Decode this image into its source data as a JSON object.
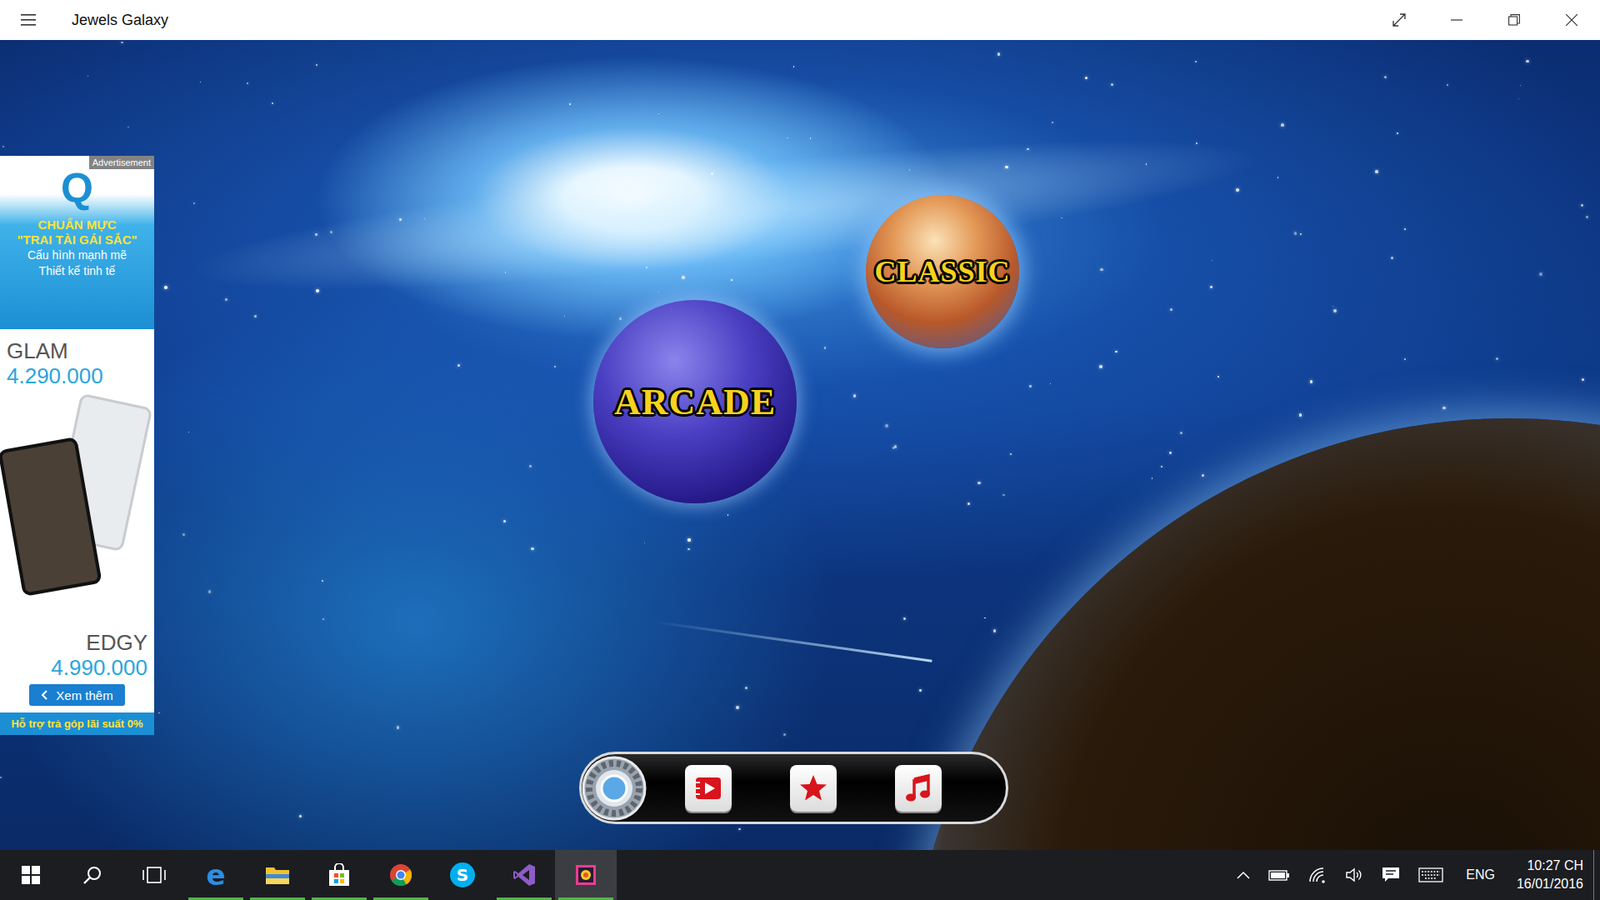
{
  "window": {
    "title": "Jewels Galaxy"
  },
  "modes": [
    {
      "label": "CLASSIC"
    },
    {
      "label": "ARCADE"
    }
  ],
  "advertisement": {
    "label": "Advertisement",
    "logo": "Q",
    "headline": [
      "CHUẨN MỰC",
      "\"TRAI TÀI GÁI SẮC\""
    ],
    "taglines": [
      "Cấu hình mạnh mẽ",
      "Thiết kế tinh tế"
    ],
    "products": [
      {
        "name": "GLAM",
        "price": "4.290.000"
      },
      {
        "name": "EDGY",
        "price": "4.990.000"
      }
    ],
    "button": "Xem thêm",
    "footer": "Hỗ trợ trả góp lãi suất 0%"
  },
  "taskbar": {
    "apps": [
      {
        "kind": "edge",
        "glyph": "e",
        "running": true,
        "selected": false
      },
      {
        "kind": "explorer",
        "running": true,
        "selected": false
      },
      {
        "kind": "store",
        "running": true,
        "selected": false
      },
      {
        "kind": "chrome",
        "running": true,
        "selected": false
      },
      {
        "kind": "skype",
        "glyph": "S",
        "running": false,
        "selected": false
      },
      {
        "kind": "studio",
        "running": true,
        "selected": false
      },
      {
        "kind": "game",
        "running": true,
        "selected": true
      }
    ],
    "tray": {
      "language": "ENG",
      "time": "10:27 CH",
      "date": "16/01/2016"
    }
  }
}
